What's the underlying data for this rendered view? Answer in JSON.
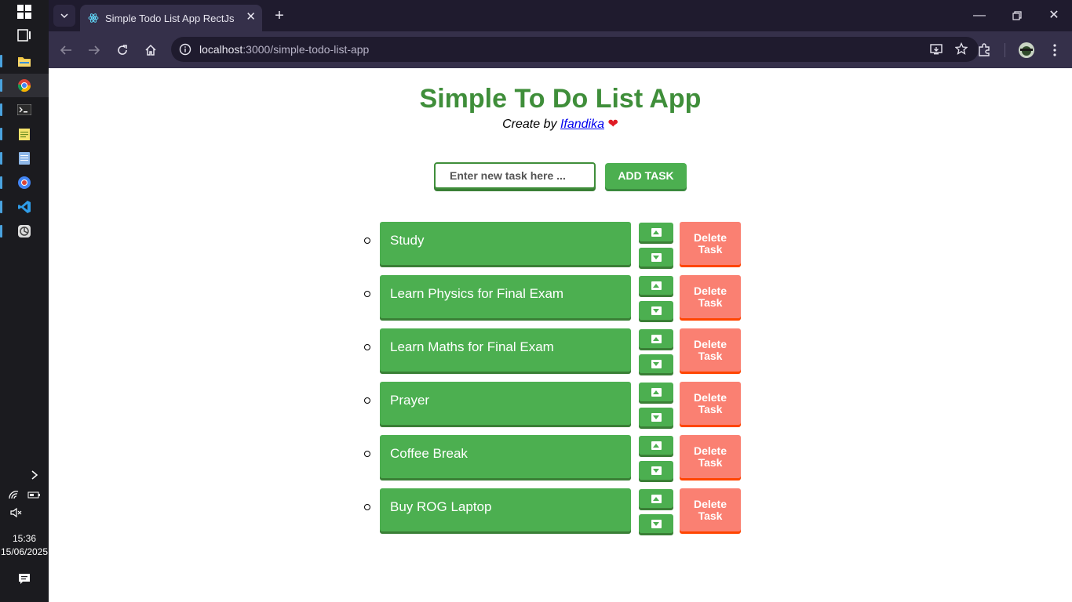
{
  "browser": {
    "tab_title": "Simple Todo List App RectJs",
    "url_host": "localhost",
    "url_path": ":3000/simple-todo-list-app"
  },
  "taskbar": {
    "time": "15:36",
    "date": "15/06/2025"
  },
  "app": {
    "title": "Simple To Do List App",
    "subtitle_prefix": "Create by",
    "author": "Ifandika",
    "heart": "❤"
  },
  "form": {
    "input_placeholder": "Enter new task here ...",
    "input_value": "",
    "add_label": "ADD TASK"
  },
  "tasks": [
    {
      "text": "Study",
      "delete_label": "Delete Task"
    },
    {
      "text": "Learn Physics for Final Exam",
      "delete_label": "Delete Task"
    },
    {
      "text": "Learn Maths for Final Exam",
      "delete_label": "Delete Task"
    },
    {
      "text": "Prayer",
      "delete_label": "Delete Task"
    },
    {
      "text": "Coffee Break",
      "delete_label": "Delete Task"
    },
    {
      "text": "Buy ROG Laptop",
      "delete_label": "Delete Task"
    }
  ],
  "colors": {
    "accent_green": "#4caf50",
    "title_green": "#3f8e3a",
    "delete_salmon": "#fa8072",
    "delete_shadow": "#ff4500"
  }
}
